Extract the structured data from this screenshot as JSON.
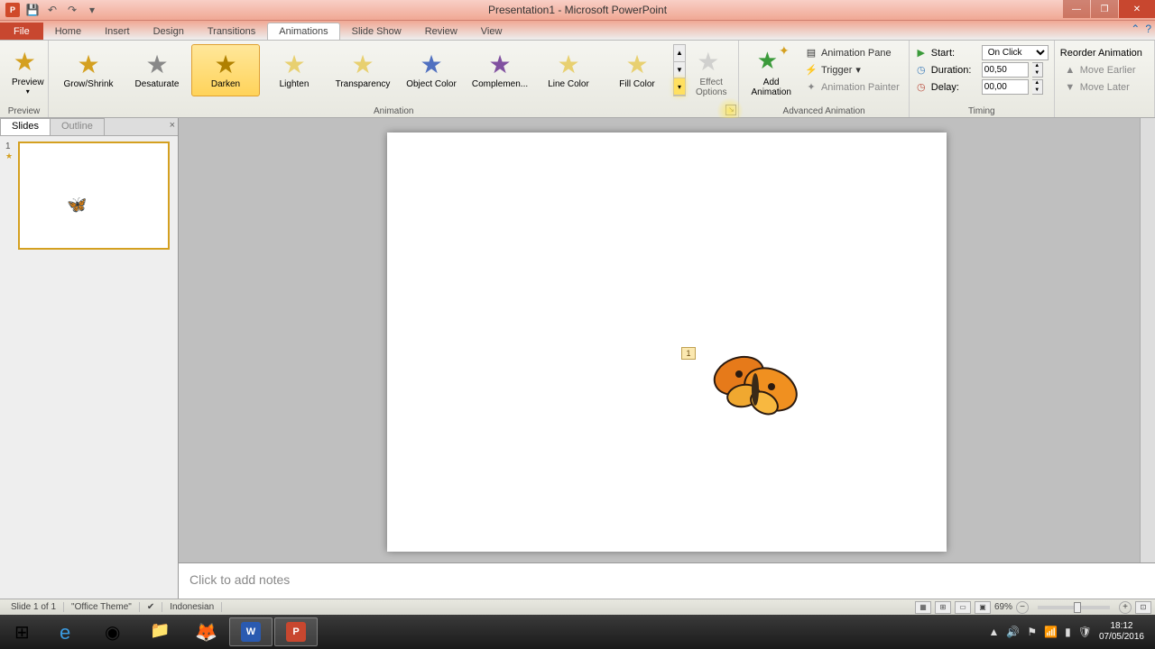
{
  "title": "Presentation1 - Microsoft PowerPoint",
  "tabs": {
    "file": "File",
    "home": "Home",
    "insert": "Insert",
    "design": "Design",
    "transitions": "Transitions",
    "animations": "Animations",
    "slideshow": "Slide Show",
    "review": "Review",
    "view": "View"
  },
  "preview": {
    "label": "Preview",
    "group": "Preview"
  },
  "animation_group": "Animation",
  "gallery": [
    {
      "label": "Grow/Shrink",
      "color": "#d4a020"
    },
    {
      "label": "Desaturate",
      "color": "#888888"
    },
    {
      "label": "Darken",
      "color": "#b08000",
      "selected": true
    },
    {
      "label": "Lighten",
      "color": "#e8d070"
    },
    {
      "label": "Transparency",
      "color": "#e8d070"
    },
    {
      "label": "Object Color",
      "color": "#5070c0"
    },
    {
      "label": "Complemen...",
      "color": "#8050a0"
    },
    {
      "label": "Line Color",
      "color": "#e8d070"
    },
    {
      "label": "Fill Color",
      "color": "#e8d070"
    }
  ],
  "effect_options": "Effect\nOptions",
  "add_animation": "Add\nAnimation",
  "advanced": {
    "pane": "Animation Pane",
    "trigger": "Trigger",
    "painter": "Animation Painter",
    "group": "Advanced Animation"
  },
  "timing": {
    "start_label": "Start:",
    "start_value": "On Click",
    "duration_label": "Duration:",
    "duration_value": "00,50",
    "delay_label": "Delay:",
    "delay_value": "00,00",
    "group": "Timing"
  },
  "reorder": {
    "title": "Reorder Animation",
    "earlier": "Move Earlier",
    "later": "Move Later"
  },
  "panel": {
    "slides": "Slides",
    "outline": "Outline"
  },
  "thumb": {
    "num": "1",
    "star": "★"
  },
  "anim_tag": "1",
  "notes_placeholder": "Click to add notes",
  "status": {
    "slide": "Slide 1 of 1",
    "theme": "\"Office Theme\"",
    "lang": "Indonesian",
    "zoom": "69%"
  },
  "clock": {
    "time": "18:12",
    "date": "07/05/2016"
  }
}
